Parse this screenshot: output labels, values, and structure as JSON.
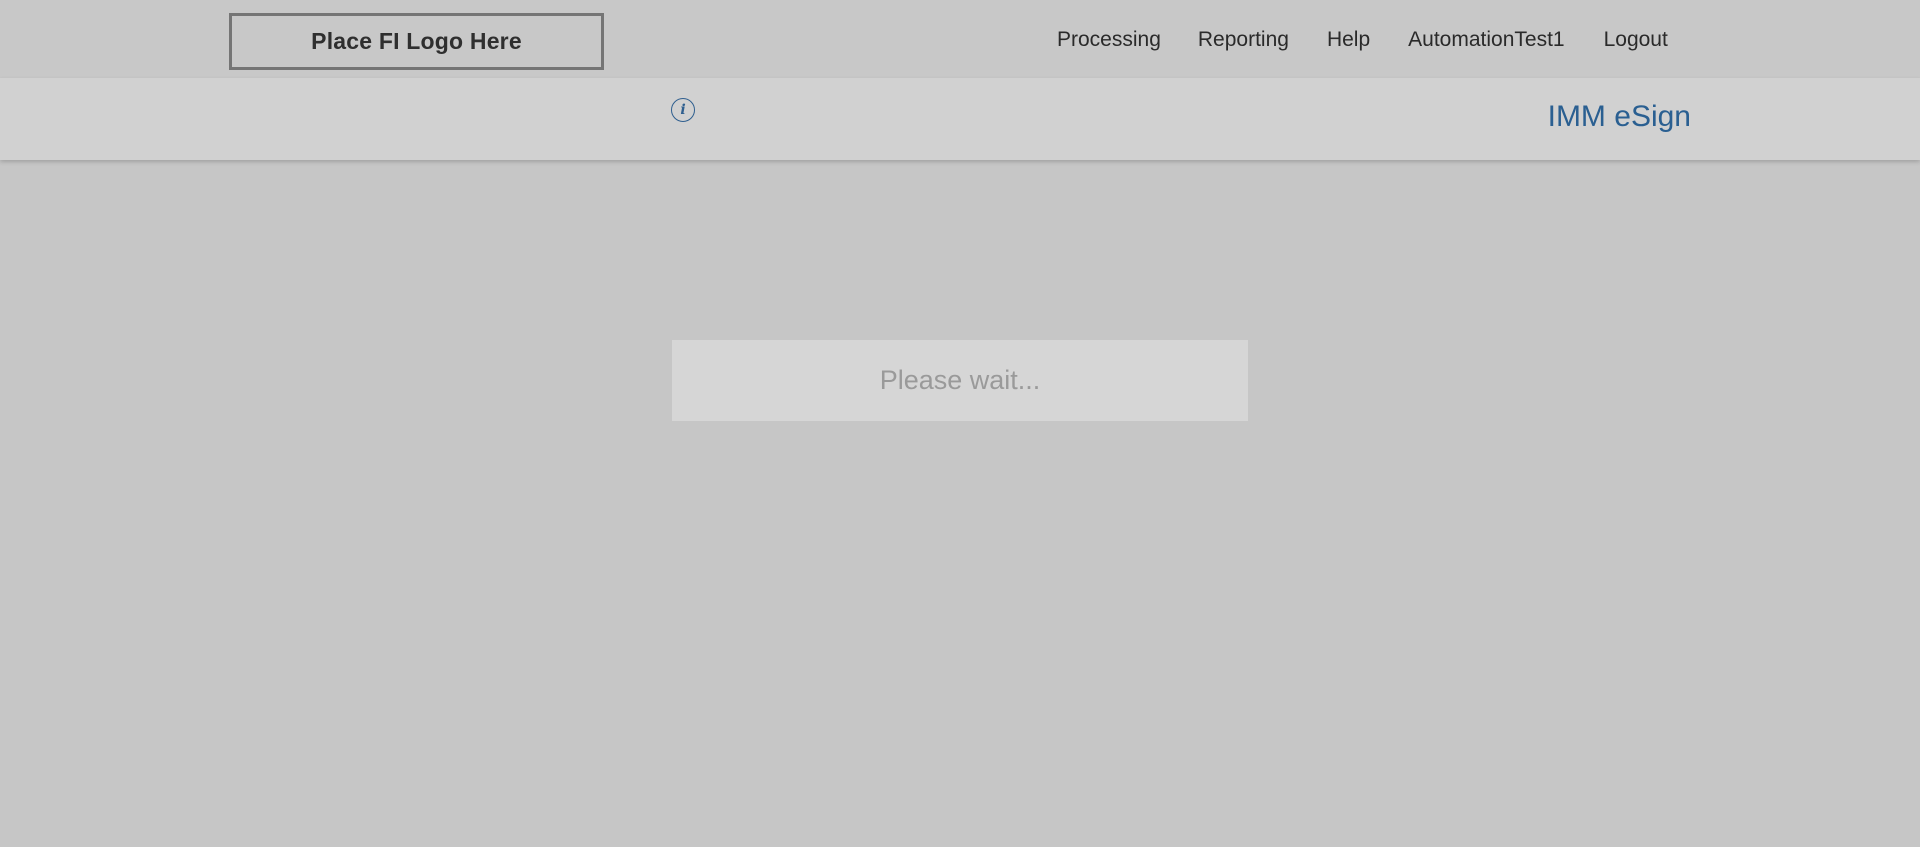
{
  "header": {
    "logo_text": "Place FI Logo Here",
    "nav": {
      "processing": "Processing",
      "reporting": "Reporting",
      "help": "Help",
      "user": "AutomationTest1",
      "logout": "Logout"
    }
  },
  "subheader": {
    "info_icon_glyph": "i",
    "brand": "IMM eSign"
  },
  "main": {
    "loading_message": "Please wait..."
  },
  "colors": {
    "page_background": "#c6c6c6",
    "brand_blue": "#2a5f91"
  }
}
